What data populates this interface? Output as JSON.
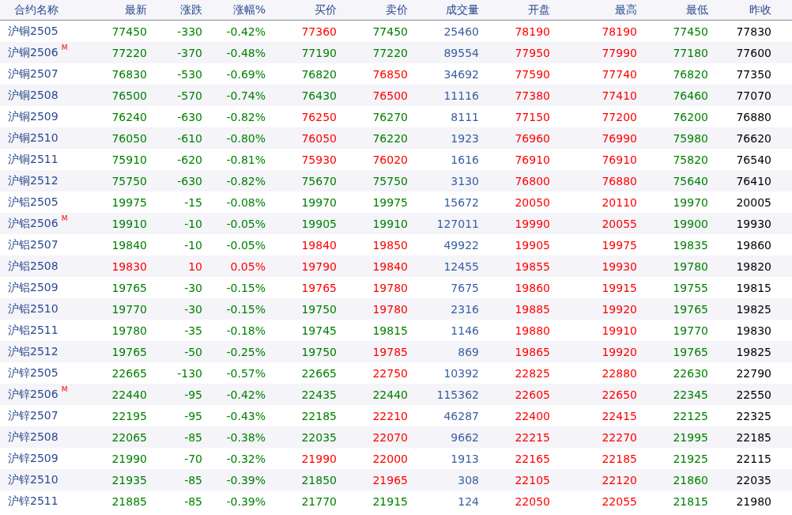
{
  "columns": [
    {
      "label": "合约名称",
      "kind": "name"
    },
    {
      "label": "最新",
      "kind": "price"
    },
    {
      "label": "涨跌",
      "kind": "price"
    },
    {
      "label": "涨幅%",
      "kind": "price"
    },
    {
      "label": "买价",
      "kind": "price"
    },
    {
      "label": "卖价",
      "kind": "price"
    },
    {
      "label": "成交量",
      "kind": "volume"
    },
    {
      "label": "开盘",
      "kind": "price"
    },
    {
      "label": "最高",
      "kind": "price"
    },
    {
      "label": "最低",
      "kind": "price"
    },
    {
      "label": "昨收",
      "kind": "close"
    }
  ],
  "rows": [
    {
      "name": "沪铜2505",
      "cells": [
        {
          "text": "77450",
          "color": "#008000"
        },
        {
          "text": "-330",
          "color": "#008000"
        },
        {
          "text": "-0.42%",
          "color": "#008000"
        },
        {
          "text": "77360",
          "color": "#ff0000"
        },
        {
          "text": "77450",
          "color": "#008000"
        },
        {
          "text": "25460"
        },
        {
          "text": "78190",
          "color": "#ff0000"
        },
        {
          "text": "78190",
          "color": "#ff0000"
        },
        {
          "text": "77450",
          "color": "#008000"
        },
        {
          "text": "77830"
        }
      ]
    },
    {
      "name": "沪铜2506",
      "badge": "M",
      "cells": [
        {
          "text": "77220",
          "color": "#008000"
        },
        {
          "text": "-370",
          "color": "#008000"
        },
        {
          "text": "-0.48%",
          "color": "#008000"
        },
        {
          "text": "77190",
          "color": "#008000"
        },
        {
          "text": "77220",
          "color": "#008000"
        },
        {
          "text": "89554"
        },
        {
          "text": "77950",
          "color": "#ff0000"
        },
        {
          "text": "77990",
          "color": "#ff0000"
        },
        {
          "text": "77180",
          "color": "#008000"
        },
        {
          "text": "77600"
        }
      ]
    },
    {
      "name": "沪铜2507",
      "cells": [
        {
          "text": "76830",
          "color": "#008000"
        },
        {
          "text": "-530",
          "color": "#008000"
        },
        {
          "text": "-0.69%",
          "color": "#008000"
        },
        {
          "text": "76820",
          "color": "#008000"
        },
        {
          "text": "76850",
          "color": "#ff0000"
        },
        {
          "text": "34692"
        },
        {
          "text": "77590",
          "color": "#ff0000"
        },
        {
          "text": "77740",
          "color": "#ff0000"
        },
        {
          "text": "76820",
          "color": "#008000"
        },
        {
          "text": "77350"
        }
      ]
    },
    {
      "name": "沪铜2508",
      "cells": [
        {
          "text": "76500",
          "color": "#008000"
        },
        {
          "text": "-570",
          "color": "#008000"
        },
        {
          "text": "-0.74%",
          "color": "#008000"
        },
        {
          "text": "76430",
          "color": "#008000"
        },
        {
          "text": "76500",
          "color": "#ff0000"
        },
        {
          "text": "11116"
        },
        {
          "text": "77380",
          "color": "#ff0000"
        },
        {
          "text": "77410",
          "color": "#ff0000"
        },
        {
          "text": "76460",
          "color": "#008000"
        },
        {
          "text": "77070"
        }
      ]
    },
    {
      "name": "沪铜2509",
      "cells": [
        {
          "text": "76240",
          "color": "#008000"
        },
        {
          "text": "-630",
          "color": "#008000"
        },
        {
          "text": "-0.82%",
          "color": "#008000"
        },
        {
          "text": "76250",
          "color": "#ff0000"
        },
        {
          "text": "76270",
          "color": "#008000"
        },
        {
          "text": "8111"
        },
        {
          "text": "77150",
          "color": "#ff0000"
        },
        {
          "text": "77200",
          "color": "#ff0000"
        },
        {
          "text": "76200",
          "color": "#008000"
        },
        {
          "text": "76880"
        }
      ]
    },
    {
      "name": "沪铜2510",
      "cells": [
        {
          "text": "76050",
          "color": "#008000"
        },
        {
          "text": "-610",
          "color": "#008000"
        },
        {
          "text": "-0.80%",
          "color": "#008000"
        },
        {
          "text": "76050",
          "color": "#ff0000"
        },
        {
          "text": "76220",
          "color": "#008000"
        },
        {
          "text": "1923"
        },
        {
          "text": "76960",
          "color": "#ff0000"
        },
        {
          "text": "76990",
          "color": "#ff0000"
        },
        {
          "text": "75980",
          "color": "#008000"
        },
        {
          "text": "76620"
        }
      ]
    },
    {
      "name": "沪铜2511",
      "cells": [
        {
          "text": "75910",
          "color": "#008000"
        },
        {
          "text": "-620",
          "color": "#008000"
        },
        {
          "text": "-0.81%",
          "color": "#008000"
        },
        {
          "text": "75930",
          "color": "#ff0000"
        },
        {
          "text": "76020",
          "color": "#ff0000"
        },
        {
          "text": "1616"
        },
        {
          "text": "76910",
          "color": "#ff0000"
        },
        {
          "text": "76910",
          "color": "#ff0000"
        },
        {
          "text": "75820",
          "color": "#008000"
        },
        {
          "text": "76540"
        }
      ]
    },
    {
      "name": "沪铜2512",
      "cells": [
        {
          "text": "75750",
          "color": "#008000"
        },
        {
          "text": "-630",
          "color": "#008000"
        },
        {
          "text": "-0.82%",
          "color": "#008000"
        },
        {
          "text": "75670",
          "color": "#008000"
        },
        {
          "text": "75750",
          "color": "#008000"
        },
        {
          "text": "3130"
        },
        {
          "text": "76800",
          "color": "#ff0000"
        },
        {
          "text": "76880",
          "color": "#ff0000"
        },
        {
          "text": "75640",
          "color": "#008000"
        },
        {
          "text": "76410"
        }
      ]
    },
    {
      "name": "沪铝2505",
      "cells": [
        {
          "text": "19975",
          "color": "#008000"
        },
        {
          "text": "-15",
          "color": "#008000"
        },
        {
          "text": "-0.08%",
          "color": "#008000"
        },
        {
          "text": "19970",
          "color": "#008000"
        },
        {
          "text": "19975",
          "color": "#008000"
        },
        {
          "text": "15672"
        },
        {
          "text": "20050",
          "color": "#ff0000"
        },
        {
          "text": "20110",
          "color": "#ff0000"
        },
        {
          "text": "19970",
          "color": "#008000"
        },
        {
          "text": "20005"
        }
      ]
    },
    {
      "name": "沪铝2506",
      "badge": "M",
      "cells": [
        {
          "text": "19910",
          "color": "#008000"
        },
        {
          "text": "-10",
          "color": "#008000"
        },
        {
          "text": "-0.05%",
          "color": "#008000"
        },
        {
          "text": "19905",
          "color": "#008000"
        },
        {
          "text": "19910",
          "color": "#008000"
        },
        {
          "text": "127011"
        },
        {
          "text": "19990",
          "color": "#ff0000"
        },
        {
          "text": "20055",
          "color": "#ff0000"
        },
        {
          "text": "19900",
          "color": "#008000"
        },
        {
          "text": "19930"
        }
      ]
    },
    {
      "name": "沪铝2507",
      "cells": [
        {
          "text": "19840",
          "color": "#008000"
        },
        {
          "text": "-10",
          "color": "#008000"
        },
        {
          "text": "-0.05%",
          "color": "#008000"
        },
        {
          "text": "19840",
          "color": "#ff0000"
        },
        {
          "text": "19850",
          "color": "#ff0000"
        },
        {
          "text": "49922"
        },
        {
          "text": "19905",
          "color": "#ff0000"
        },
        {
          "text": "19975",
          "color": "#ff0000"
        },
        {
          "text": "19835",
          "color": "#008000"
        },
        {
          "text": "19860"
        }
      ]
    },
    {
      "name": "沪铝2508",
      "cells": [
        {
          "text": "19830",
          "color": "#ff0000"
        },
        {
          "text": "10",
          "color": "#ff0000"
        },
        {
          "text": "0.05%",
          "color": "#ff0000"
        },
        {
          "text": "19790",
          "color": "#ff0000"
        },
        {
          "text": "19840",
          "color": "#ff0000"
        },
        {
          "text": "12455"
        },
        {
          "text": "19855",
          "color": "#ff0000"
        },
        {
          "text": "19930",
          "color": "#ff0000"
        },
        {
          "text": "19780",
          "color": "#008000"
        },
        {
          "text": "19820"
        }
      ]
    },
    {
      "name": "沪铝2509",
      "cells": [
        {
          "text": "19765",
          "color": "#008000"
        },
        {
          "text": "-30",
          "color": "#008000"
        },
        {
          "text": "-0.15%",
          "color": "#008000"
        },
        {
          "text": "19765",
          "color": "#ff0000"
        },
        {
          "text": "19780",
          "color": "#ff0000"
        },
        {
          "text": "7675"
        },
        {
          "text": "19860",
          "color": "#ff0000"
        },
        {
          "text": "19915",
          "color": "#ff0000"
        },
        {
          "text": "19755",
          "color": "#008000"
        },
        {
          "text": "19815"
        }
      ]
    },
    {
      "name": "沪铝2510",
      "cells": [
        {
          "text": "19770",
          "color": "#008000"
        },
        {
          "text": "-30",
          "color": "#008000"
        },
        {
          "text": "-0.15%",
          "color": "#008000"
        },
        {
          "text": "19750",
          "color": "#008000"
        },
        {
          "text": "19780",
          "color": "#ff0000"
        },
        {
          "text": "2316"
        },
        {
          "text": "19885",
          "color": "#ff0000"
        },
        {
          "text": "19920",
          "color": "#ff0000"
        },
        {
          "text": "19765",
          "color": "#008000"
        },
        {
          "text": "19825"
        }
      ]
    },
    {
      "name": "沪铝2511",
      "cells": [
        {
          "text": "19780",
          "color": "#008000"
        },
        {
          "text": "-35",
          "color": "#008000"
        },
        {
          "text": "-0.18%",
          "color": "#008000"
        },
        {
          "text": "19745",
          "color": "#008000"
        },
        {
          "text": "19815",
          "color": "#008000"
        },
        {
          "text": "1146"
        },
        {
          "text": "19880",
          "color": "#ff0000"
        },
        {
          "text": "19910",
          "color": "#ff0000"
        },
        {
          "text": "19770",
          "color": "#008000"
        },
        {
          "text": "19830"
        }
      ]
    },
    {
      "name": "沪铝2512",
      "cells": [
        {
          "text": "19765",
          "color": "#008000"
        },
        {
          "text": "-50",
          "color": "#008000"
        },
        {
          "text": "-0.25%",
          "color": "#008000"
        },
        {
          "text": "19750",
          "color": "#008000"
        },
        {
          "text": "19785",
          "color": "#ff0000"
        },
        {
          "text": "869"
        },
        {
          "text": "19865",
          "color": "#ff0000"
        },
        {
          "text": "19920",
          "color": "#ff0000"
        },
        {
          "text": "19765",
          "color": "#008000"
        },
        {
          "text": "19825"
        }
      ]
    },
    {
      "name": "沪锌2505",
      "cells": [
        {
          "text": "22665",
          "color": "#008000"
        },
        {
          "text": "-130",
          "color": "#008000"
        },
        {
          "text": "-0.57%",
          "color": "#008000"
        },
        {
          "text": "22665",
          "color": "#008000"
        },
        {
          "text": "22750",
          "color": "#ff0000"
        },
        {
          "text": "10392"
        },
        {
          "text": "22825",
          "color": "#ff0000"
        },
        {
          "text": "22880",
          "color": "#ff0000"
        },
        {
          "text": "22630",
          "color": "#008000"
        },
        {
          "text": "22790"
        }
      ]
    },
    {
      "name": "沪锌2506",
      "badge": "M",
      "cells": [
        {
          "text": "22440",
          "color": "#008000"
        },
        {
          "text": "-95",
          "color": "#008000"
        },
        {
          "text": "-0.42%",
          "color": "#008000"
        },
        {
          "text": "22435",
          "color": "#008000"
        },
        {
          "text": "22440",
          "color": "#008000"
        },
        {
          "text": "115362"
        },
        {
          "text": "22605",
          "color": "#ff0000"
        },
        {
          "text": "22650",
          "color": "#ff0000"
        },
        {
          "text": "22345",
          "color": "#008000"
        },
        {
          "text": "22550"
        }
      ]
    },
    {
      "name": "沪锌2507",
      "cells": [
        {
          "text": "22195",
          "color": "#008000"
        },
        {
          "text": "-95",
          "color": "#008000"
        },
        {
          "text": "-0.43%",
          "color": "#008000"
        },
        {
          "text": "22185",
          "color": "#008000"
        },
        {
          "text": "22210",
          "color": "#ff0000"
        },
        {
          "text": "46287"
        },
        {
          "text": "22400",
          "color": "#ff0000"
        },
        {
          "text": "22415",
          "color": "#ff0000"
        },
        {
          "text": "22125",
          "color": "#008000"
        },
        {
          "text": "22325"
        }
      ]
    },
    {
      "name": "沪锌2508",
      "cells": [
        {
          "text": "22065",
          "color": "#008000"
        },
        {
          "text": "-85",
          "color": "#008000"
        },
        {
          "text": "-0.38%",
          "color": "#008000"
        },
        {
          "text": "22035",
          "color": "#008000"
        },
        {
          "text": "22070",
          "color": "#ff0000"
        },
        {
          "text": "9662"
        },
        {
          "text": "22215",
          "color": "#ff0000"
        },
        {
          "text": "22270",
          "color": "#ff0000"
        },
        {
          "text": "21995",
          "color": "#008000"
        },
        {
          "text": "22185"
        }
      ]
    },
    {
      "name": "沪锌2509",
      "cells": [
        {
          "text": "21990",
          "color": "#008000"
        },
        {
          "text": "-70",
          "color": "#008000"
        },
        {
          "text": "-0.32%",
          "color": "#008000"
        },
        {
          "text": "21990",
          "color": "#ff0000"
        },
        {
          "text": "22000",
          "color": "#ff0000"
        },
        {
          "text": "1913"
        },
        {
          "text": "22165",
          "color": "#ff0000"
        },
        {
          "text": "22185",
          "color": "#ff0000"
        },
        {
          "text": "21925",
          "color": "#008000"
        },
        {
          "text": "22115"
        }
      ]
    },
    {
      "name": "沪锌2510",
      "cells": [
        {
          "text": "21935",
          "color": "#008000"
        },
        {
          "text": "-85",
          "color": "#008000"
        },
        {
          "text": "-0.39%",
          "color": "#008000"
        },
        {
          "text": "21850",
          "color": "#008000"
        },
        {
          "text": "21965",
          "color": "#ff0000"
        },
        {
          "text": "308"
        },
        {
          "text": "22105",
          "color": "#ff0000"
        },
        {
          "text": "22120",
          "color": "#ff0000"
        },
        {
          "text": "21860",
          "color": "#008000"
        },
        {
          "text": "22035"
        }
      ]
    },
    {
      "name": "沪锌2511",
      "cells": [
        {
          "text": "21885",
          "color": "#008000"
        },
        {
          "text": "-85",
          "color": "#008000"
        },
        {
          "text": "-0.39%",
          "color": "#008000"
        },
        {
          "text": "21770",
          "color": "#008000"
        },
        {
          "text": "21915",
          "color": "#008000"
        },
        {
          "text": "124"
        },
        {
          "text": "22050",
          "color": "#ff0000"
        },
        {
          "text": "22055",
          "color": "#ff0000"
        },
        {
          "text": "21815",
          "color": "#008000"
        },
        {
          "text": "21980"
        }
      ]
    }
  ]
}
